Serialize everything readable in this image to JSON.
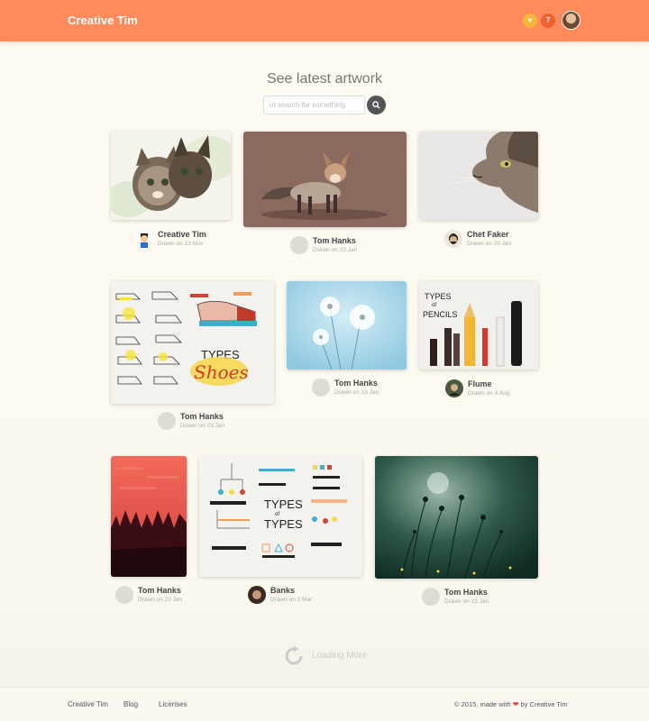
{
  "header": {
    "brand": "Creative Tim",
    "heart_badge_icon": "heart-icon",
    "notification_count": "7",
    "accent": "#ff8a5c"
  },
  "main": {
    "title": "See latest artwork",
    "search": {
      "placeholder": "or search for something",
      "button_icon": "search-icon"
    }
  },
  "artworks": [
    {
      "subject": "kittens",
      "author": "Creative Tim",
      "date": "Drawn on 23 Nov"
    },
    {
      "subject": "fox",
      "author": "Tom Hanks",
      "date": "Drawn on 23 Jan"
    },
    {
      "subject": "cat profile",
      "author": "Chet Faker",
      "date": "Drawn on 20 Jan"
    },
    {
      "subject": "types of shoes",
      "author": "Tom Hanks",
      "date": "Drawn on 23 Jan"
    },
    {
      "subject": "dandelions",
      "author": "Tom Hanks",
      "date": "Drawn on 23 Jan"
    },
    {
      "subject": "types of pencils",
      "author": "Flume",
      "date": "Drawn on 4 Aug"
    },
    {
      "subject": "red forest",
      "author": "Tom Hanks",
      "date": "Drawn on 23 Jan"
    },
    {
      "subject": "types of types",
      "author": "Banks",
      "date": "Drawn on 3 Mar"
    },
    {
      "subject": "green plants",
      "author": "Tom Hanks",
      "date": "Drawn on 23 Jan"
    }
  ],
  "loading": {
    "label": "Loading More"
  },
  "footer": {
    "links": [
      "Creative Tim",
      "Blog",
      "Licenses"
    ],
    "copyright_prefix": "© 2015, made with",
    "copyright_suffix": "by Creative Tim"
  }
}
